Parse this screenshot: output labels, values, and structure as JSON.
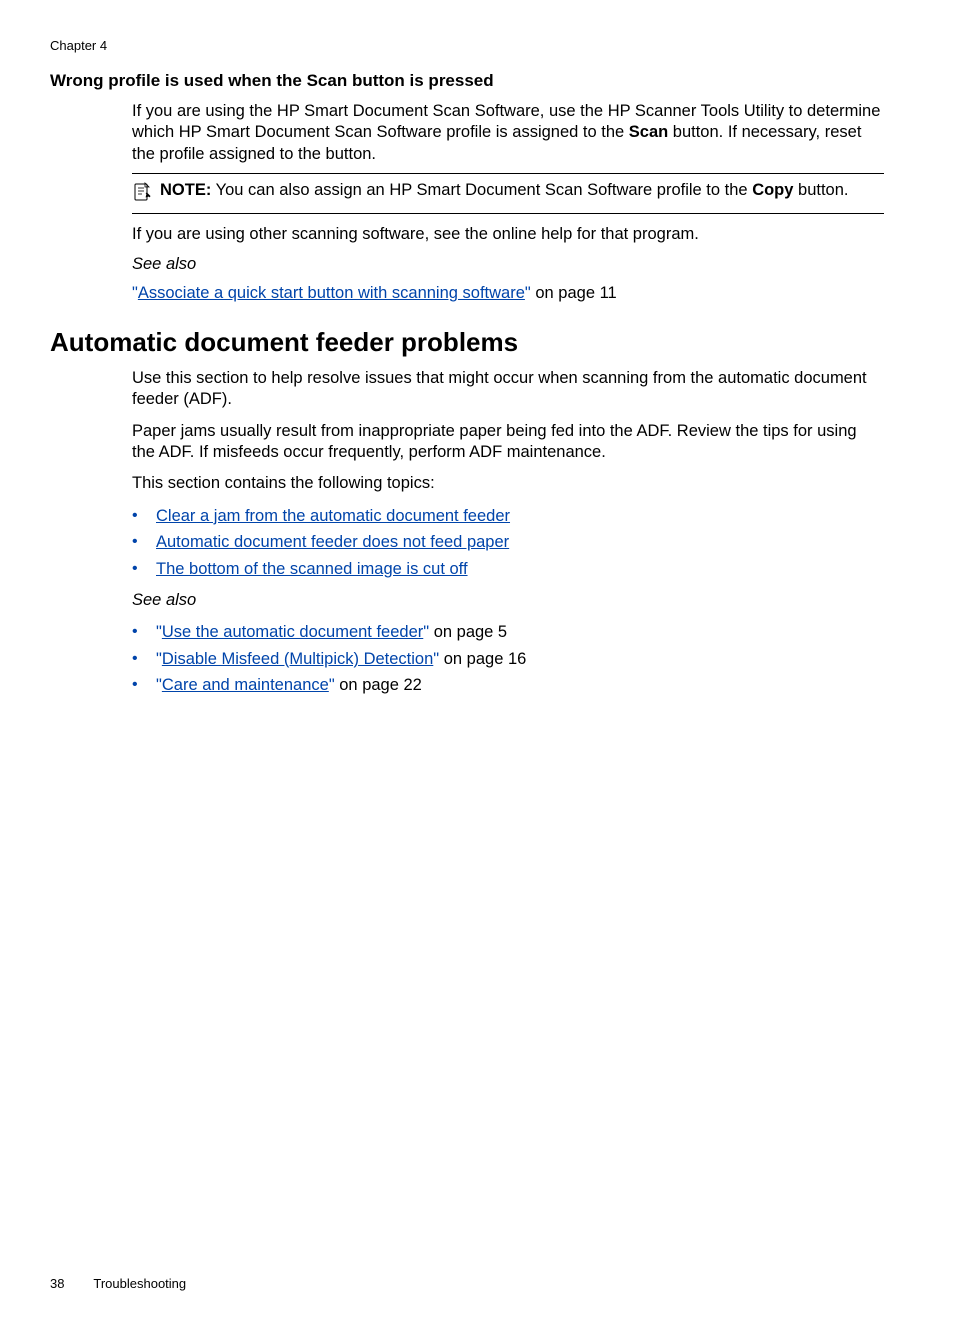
{
  "chapter": "Chapter 4",
  "section1": {
    "heading": "Wrong profile is used when the Scan button is pressed",
    "para1_a": "If you are using the HP Smart Document Scan Software, use the HP Scanner Tools Utility to determine which HP Smart Document Scan Software profile is assigned to the ",
    "para1_bold1": "Scan",
    "para1_b": " button. If necessary, reset the profile assigned to the button.",
    "note_label": "NOTE:",
    "note_text_a": "  You can also assign an HP Smart Document Scan Software profile to the ",
    "note_bold": "Copy",
    "note_text_b": " button.",
    "para2": "If you are using other scanning software, see the online help for that program.",
    "see_also": "See also",
    "link_text": "Associate a quick start button with scanning software",
    "link_suffix": " on page 11"
  },
  "section2": {
    "heading": "Automatic document feeder problems",
    "para1": "Use this section to help resolve issues that might occur when scanning from the automatic document feeder (ADF).",
    "para2": "Paper jams usually result from inappropriate paper being fed into the ADF. Review the tips for using the ADF. If misfeeds occur frequently, perform ADF maintenance.",
    "para3": "This section contains the following topics:",
    "topics": [
      "Clear a jam from the automatic document feeder",
      "Automatic document feeder does not feed paper",
      "The bottom of the scanned image is cut off"
    ],
    "see_also": "See also",
    "see_also_items": [
      {
        "link": "Use the automatic document feeder",
        "suffix": " on page 5"
      },
      {
        "link": "Disable Misfeed (Multipick) Detection",
        "suffix": " on page 16"
      },
      {
        "link": "Care and maintenance",
        "suffix": " on page 22"
      }
    ]
  },
  "footer": {
    "page": "38",
    "title": "Troubleshooting"
  }
}
